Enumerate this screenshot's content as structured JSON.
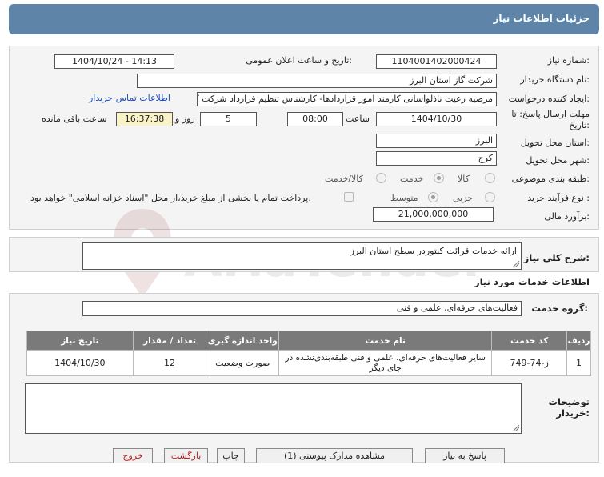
{
  "header": {
    "title": "جزئیات اطلاعات نیاز"
  },
  "fields": {
    "need_number_label": "شماره نیاز:",
    "need_number": "1104001402000424",
    "announce_label": "تاریخ و ساعت اعلان عمومی:",
    "announce_value": "1404/10/24 - 14:13",
    "buyer_org_label": "نام دستگاه خریدار:",
    "buyer_org": "شرکت گاز استان البرز",
    "requester_label": "ایجاد کننده درخواست:",
    "requester": "مرضیه رعیت ناذلواسانی کارمند امور قراردادها- کارشناس تنظیم قرارداد شرکت گاز استان البرز",
    "contact_link": "اطلاعات تماس خریدار",
    "deadline_label_1": "مهلت ارسال پاسخ: تا",
    "deadline_label_2": "تاریخ:",
    "deadline_date": "1404/10/30",
    "time_label": "ساعت",
    "deadline_time": "08:00",
    "days_value": "5",
    "days_label": "روز و",
    "remaining_time": "16:37:38",
    "remaining_label": "ساعت باقی مانده",
    "province_label": "استان محل تحویل:",
    "province": "البرز",
    "city_label": "شهر محل تحویل:",
    "city": "کرج",
    "category_label": "طبقه بندی موضوعی:",
    "category_options": [
      "کالا",
      "خدمت",
      "کالا/خدمت"
    ],
    "category_selected": "خدمت",
    "purchase_type_label": "نوع فرآیند خرید :",
    "purchase_options": [
      "جزیی",
      "متوسط"
    ],
    "purchase_selected": "متوسط",
    "payment_note": "پرداخت تمام یا بخشی از مبلغ خرید،از محل \"اسناد خزانه اسلامی\" خواهد بود.",
    "budget_label": "برآورد مالی:",
    "budget": "21,000,000,000"
  },
  "description": {
    "label": "شرح کلی نیاز:",
    "value": "ارائه خدمات قرائت کنتوردر سطح استان البرز"
  },
  "services": {
    "section_title": "اطلاعات خدمات مورد نیاز",
    "group_label": "گروه خدمت:",
    "group_value": "فعالیت‌های حرفه‌ای، علمی و فنی"
  },
  "table": {
    "headers": [
      "ردیف",
      "کد خدمت",
      "نام خدمت",
      "واحد اندازه گیری",
      "تعداد / مقدار",
      "تاریخ نیاز"
    ],
    "rows": [
      [
        "1",
        "ز-74-749",
        "سایر فعالیت‌های حرفه‌ای، علمی و فنی طبقه‌بندی‌نشده در جای دیگر",
        "صورت وضعیت",
        "12",
        "1404/10/30"
      ]
    ]
  },
  "buyer_notes": {
    "label_1": "توضیحات",
    "label_2": "خریدار:",
    "value": ""
  },
  "buttons": {
    "reply": "پاسخ به نیاز",
    "attachments": "مشاهده مدارک پیوستی (1)",
    "print": "چاپ",
    "back": "بازگشت",
    "exit": "خروج"
  },
  "watermark": {
    "text": "AriaTender.neT"
  }
}
